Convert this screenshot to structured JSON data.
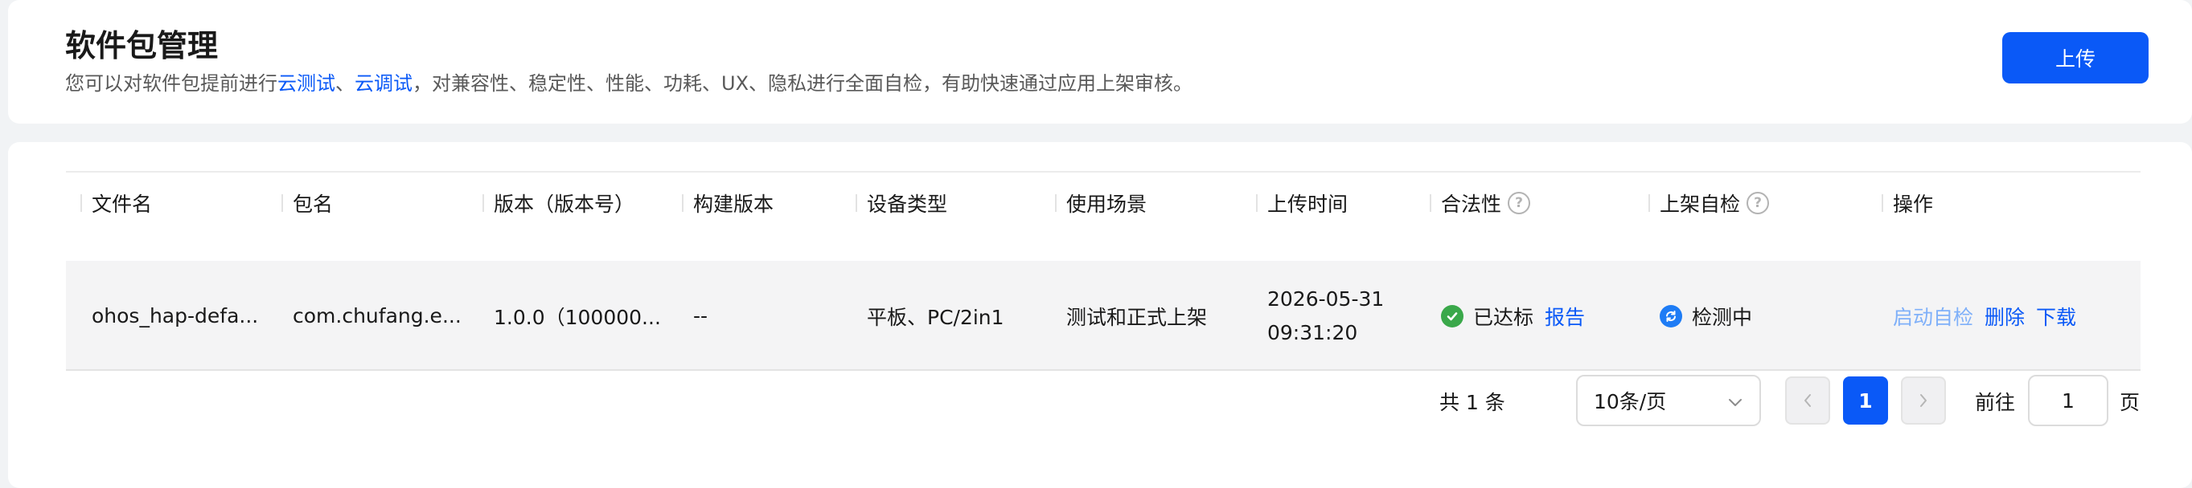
{
  "header": {
    "title": "软件包管理",
    "desc_prefix": "您可以对软件包提前进行",
    "desc_link1": "云测试",
    "desc_sep": "、",
    "desc_link2": "云调试",
    "desc_suffix": "，对兼容性、稳定性、性能、功耗、UX、隐私进行全面自检，有助快速通过应用上架审核。",
    "upload_label": "上传"
  },
  "table": {
    "columns": [
      "文件名",
      "包名",
      "版本（版本号）",
      "构建版本",
      "设备类型",
      "使用场景",
      "上传时间",
      "合法性",
      "上架自检",
      "操作"
    ],
    "help_icon": "?",
    "rows": [
      {
        "file_name": "ohos_hap-defa...",
        "package_name": "com.chufang.e...",
        "version": "1.0.0（100000...",
        "build_version": "--",
        "device_type": "平板、PC/2in1",
        "scenario": "测试和正式上架",
        "upload_date": "2026-05-31",
        "upload_time": "09:31:20",
        "legality": "已达标",
        "legality_link": "报告",
        "self_check": "检测中",
        "actions": [
          "启动自检",
          "删除",
          "下载"
        ]
      }
    ]
  },
  "pagination": {
    "total_text": "共 1 条",
    "page_size": "10条/页",
    "current_page": "1",
    "goto_label": "前往",
    "goto_value": "1",
    "goto_suffix": "页"
  },
  "colors": {
    "primary": "#0a59f7",
    "success": "#3aa84a",
    "running": "#1e7cf5"
  }
}
